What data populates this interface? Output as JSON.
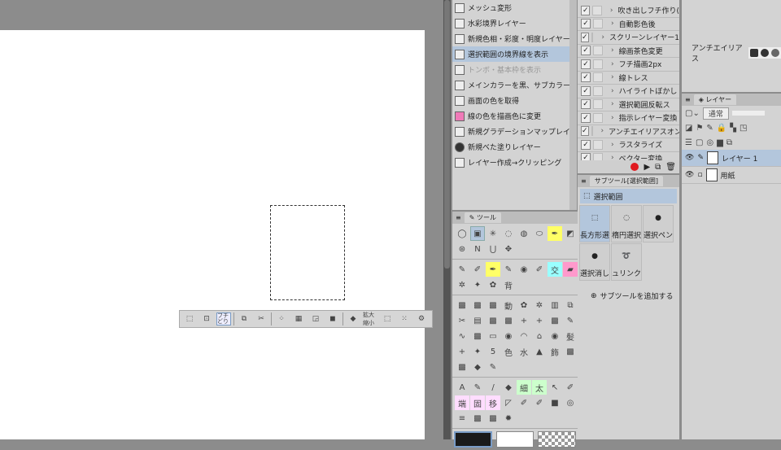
{
  "command_bar": {
    "items": [
      {
        "label": "メッシュ変形",
        "icon": "mesh-transform-icon"
      },
      {
        "label": "水彩境界レイヤー",
        "icon": "folder-icon"
      },
      {
        "label": "新規色相・彩度・明度レイヤー",
        "icon": "adjust-layer-icon"
      },
      {
        "label": "選択範囲の境界線を表示",
        "icon": "selection-border-icon",
        "selected": true
      },
      {
        "label": "トンボ・基本枠を表示",
        "icon": "crop-mark-icon",
        "disabled": true
      },
      {
        "label": "メインカラーを黒、サブカラーを白に変更",
        "icon": "color-reset-icon"
      },
      {
        "label": "画面の色を取得",
        "icon": "eyedropper-icon"
      },
      {
        "label": "線の色を描画色に変更",
        "icon": "line-color-icon"
      },
      {
        "label": "新規グラデーションマップレイヤー",
        "icon": "gradient-map-icon"
      },
      {
        "label": "新規べた塗りレイヤー",
        "icon": "fill-layer-icon"
      },
      {
        "label": "レイヤー作成→クリッピング",
        "icon": "folder-icon"
      }
    ]
  },
  "auto_actions": {
    "items": [
      {
        "label": "吹き出しフチ作り(",
        "checked": true
      },
      {
        "label": "自動影色後",
        "checked": true
      },
      {
        "label": "スクリーンレイヤー1",
        "checked": true
      },
      {
        "label": "線画茶色変更",
        "checked": true
      },
      {
        "label": "フチ描画2px",
        "checked": true
      },
      {
        "label": "線トレス",
        "checked": true
      },
      {
        "label": "ハイライトぼかし",
        "checked": true
      },
      {
        "label": "選択範囲反転ス",
        "checked": true
      },
      {
        "label": "指示レイヤー変換",
        "checked": true
      },
      {
        "label": "アンチエイリアスオン",
        "checked": true
      },
      {
        "label": "ラスタライズ",
        "checked": true
      },
      {
        "label": "ベクター変換",
        "checked": true
      }
    ],
    "record_color": "#e0191f"
  },
  "subtool": {
    "tab": "サブツール[選択範囲]",
    "group": "選択範囲",
    "items": [
      "長方形選",
      "楕円選択",
      "選択ペン",
      "選択消し",
      "シュリンク選"
    ],
    "active": 0,
    "add_label": "サブツールを追加する"
  },
  "tools": {
    "tab": "ツール"
  },
  "selection_toolbar": {
    "buttons": [
      "transform",
      "crop",
      "フチどり",
      "copy-paste",
      "cut-paste",
      "deselect",
      "invert",
      "expand",
      "fill",
      "拡大縮小",
      "clear",
      "shrink",
      "settings"
    ]
  },
  "colors": {
    "main": "#1a1a1a",
    "sub": "#ffffff"
  },
  "tool_property": {
    "antialias_label": "アンチエイリアス"
  },
  "layer_panel": {
    "tab": "レイヤー",
    "blend_mode": "通常",
    "layers": [
      {
        "name": "レイヤー 1",
        "selected": true
      },
      {
        "name": "用紙",
        "selected": false
      }
    ]
  }
}
